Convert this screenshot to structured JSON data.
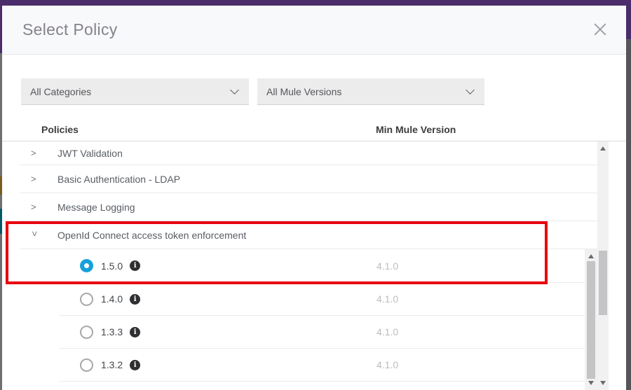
{
  "modal": {
    "title": "Select Policy"
  },
  "icons": {
    "close": "x",
    "chevron": ">",
    "dropdown_chevron": "v",
    "info": "i"
  },
  "filters": {
    "categories": "All Categories",
    "mule_versions": "All Mule Versions"
  },
  "table": {
    "columns": [
      "Policies",
      "Min Mule Version"
    ],
    "rows": [
      {
        "label": "JWT Validation",
        "expanded": false
      },
      {
        "label": "Basic Authentication - LDAP",
        "expanded": false
      },
      {
        "label": "Message Logging",
        "expanded": false
      },
      {
        "label": "OpenId Connect access token enforcement",
        "expanded": true,
        "versions": [
          {
            "version": "1.5.0",
            "min_mule_version": "4.1.0",
            "selected": true
          },
          {
            "version": "1.4.0",
            "min_mule_version": "4.1.0",
            "selected": false
          },
          {
            "version": "1.3.3",
            "min_mule_version": "4.1.0",
            "selected": false
          },
          {
            "version": "1.3.2",
            "min_mule_version": "4.1.0",
            "selected": false
          }
        ]
      }
    ]
  },
  "colors": {
    "brand_purple": "#4b2d6b",
    "accent_blue": "#17a0da",
    "annotation_red": "#e8000d"
  }
}
